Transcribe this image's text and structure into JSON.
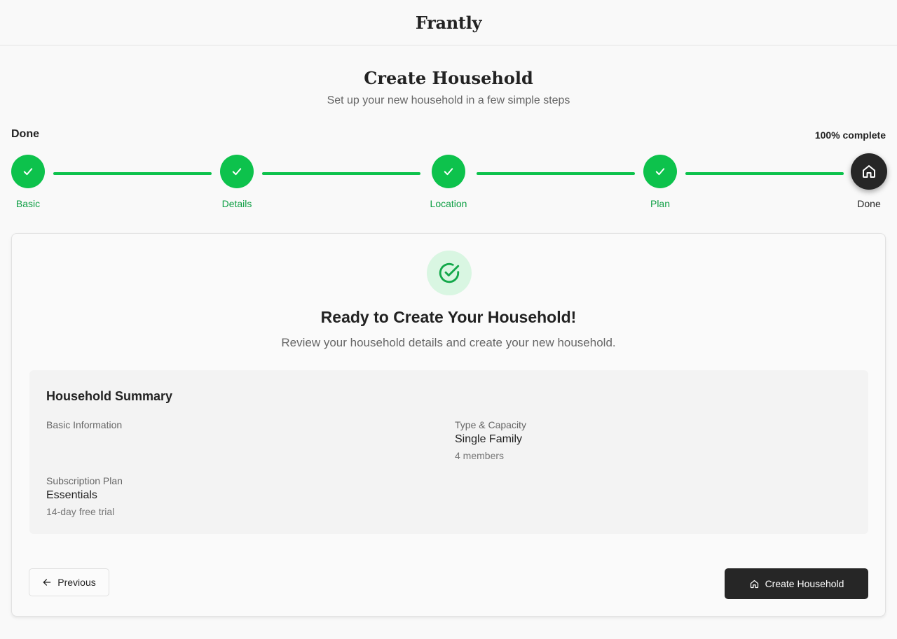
{
  "app": {
    "brand": "Frantly"
  },
  "header": {
    "title": "Create Household",
    "subtitle": "Set up your new household in a few simple steps"
  },
  "progress": {
    "current_step_label": "Done",
    "percent_text": "100% complete",
    "percent": 100
  },
  "steps": [
    {
      "label": "Basic",
      "status": "complete",
      "icon": "check-icon"
    },
    {
      "label": "Details",
      "status": "complete",
      "icon": "check-icon"
    },
    {
      "label": "Location",
      "status": "complete",
      "icon": "check-icon"
    },
    {
      "label": "Plan",
      "status": "complete",
      "icon": "check-icon"
    },
    {
      "label": "Done",
      "status": "current",
      "icon": "home-icon"
    }
  ],
  "card": {
    "badge_icon": "check-circle-icon",
    "heading": "Ready to Create Your Household!",
    "subheading": "Review your household details and create your new household."
  },
  "summary": {
    "title": "Household Summary",
    "basic": {
      "label": "Basic Information"
    },
    "type": {
      "label": "Type & Capacity",
      "value": "Single Family",
      "note": "4 members"
    },
    "plan": {
      "label": "Subscription Plan",
      "value": "Essentials",
      "note": "14-day free trial"
    }
  },
  "actions": {
    "previous_label": "Previous",
    "previous_icon": "arrow-left-icon",
    "create_label": "Create Household",
    "create_icon": "home-icon"
  },
  "colors": {
    "success": "#0dc24c",
    "dark": "#262626",
    "success_light": "#d9f6e2"
  }
}
